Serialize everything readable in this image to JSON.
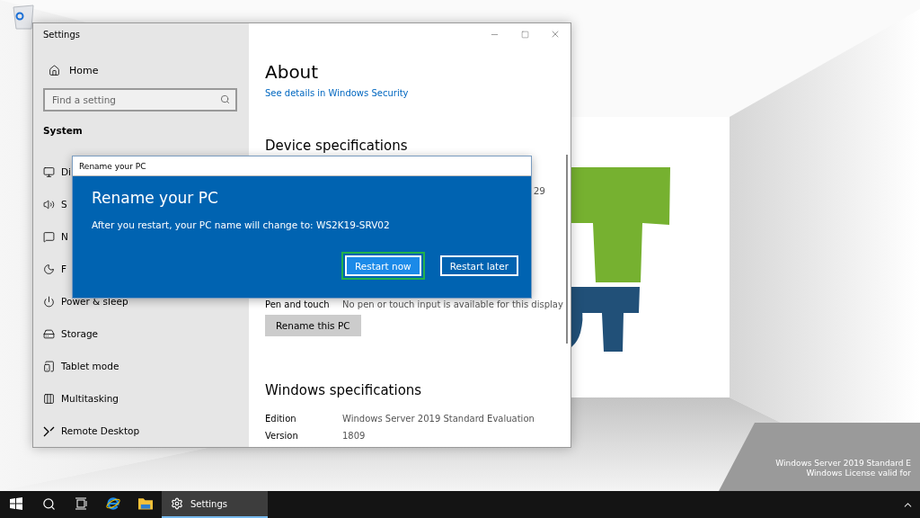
{
  "desktop": {
    "recycle_bin": {
      "kind": "icon"
    },
    "watermark": [
      "Windows Server 2019 Standard E",
      "Windows License valid for"
    ]
  },
  "settings_window": {
    "title": "Settings",
    "sidebar": {
      "home": "Home",
      "search": {
        "placeholder": "Find a setting"
      },
      "section": "System",
      "items": [
        {
          "label": "Di",
          "kind": "display",
          "selected": false
        },
        {
          "label": "S",
          "kind": "sound",
          "selected": false
        },
        {
          "label": "N",
          "kind": "notifications",
          "selected": false
        },
        {
          "label": "F",
          "kind": "focus",
          "selected": false
        },
        {
          "label": "Power & sleep",
          "kind": "power",
          "selected": false
        },
        {
          "label": "Storage",
          "kind": "storage",
          "selected": false
        },
        {
          "label": "Tablet mode",
          "kind": "tablet",
          "selected": false
        },
        {
          "label": "Multitasking",
          "kind": "multitasking",
          "selected": false
        },
        {
          "label": "Remote Desktop",
          "kind": "remote",
          "selected": false
        }
      ]
    },
    "content": {
      "title": "About",
      "link": "See details in Windows Security",
      "device_heading": "Device specifications",
      "partial_value": "29",
      "pen_row": {
        "label": "Pen and touch",
        "value": "No pen or touch input is available for this display"
      },
      "rename_button": "Rename this PC",
      "windows_heading": "Windows specifications",
      "windows_rows": [
        {
          "label": "Edition",
          "value": "Windows Server 2019 Standard Evaluation"
        },
        {
          "label": "Version",
          "value": "1809"
        }
      ]
    }
  },
  "dialog": {
    "title": "Rename your PC",
    "heading": "Rename your PC",
    "message": "After you restart, your PC name will change to: WS2K19-SRV02",
    "buttons": [
      {
        "label": "Restart now",
        "kind": "primary",
        "focused": true
      },
      {
        "label": "Restart later",
        "kind": "secondary",
        "focused": false
      }
    ]
  },
  "taskbar": {
    "items": [
      {
        "kind": "start",
        "active": false
      },
      {
        "kind": "search",
        "active": false
      },
      {
        "kind": "taskview",
        "active": false
      },
      {
        "kind": "browser",
        "active": false
      },
      {
        "kind": "folder",
        "active": false
      },
      {
        "kind": "settings",
        "label": "Settings",
        "active": true
      }
    ]
  }
}
